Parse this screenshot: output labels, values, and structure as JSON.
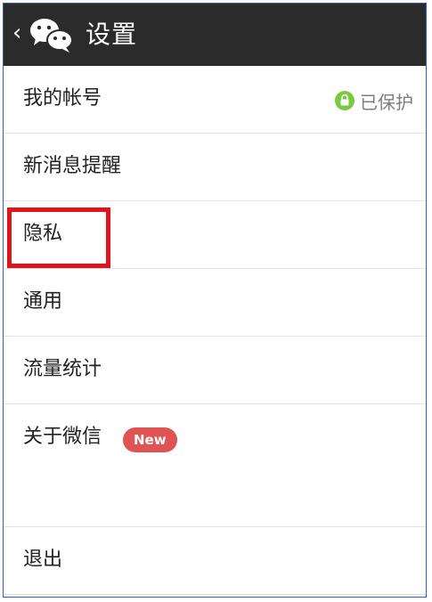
{
  "topbar": {
    "back_icon": "chevron-left-icon",
    "logo_icon": "wechat-logo-icon",
    "title": "设置"
  },
  "items": [
    {
      "label": "我的帐号",
      "status": "已保护",
      "status_icon": "lock-icon"
    },
    {
      "label": "新消息提醒"
    },
    {
      "label": "隐私"
    },
    {
      "label": "通用"
    },
    {
      "label": "流量统计"
    },
    {
      "label": "关于微信",
      "badge": "New"
    },
    {
      "label": "退出"
    }
  ],
  "colors": {
    "topbar_bg": "#2b2b2b",
    "status_green": "#7ac943",
    "badge_red": "#e05353",
    "highlight_red": "#e0141d"
  }
}
